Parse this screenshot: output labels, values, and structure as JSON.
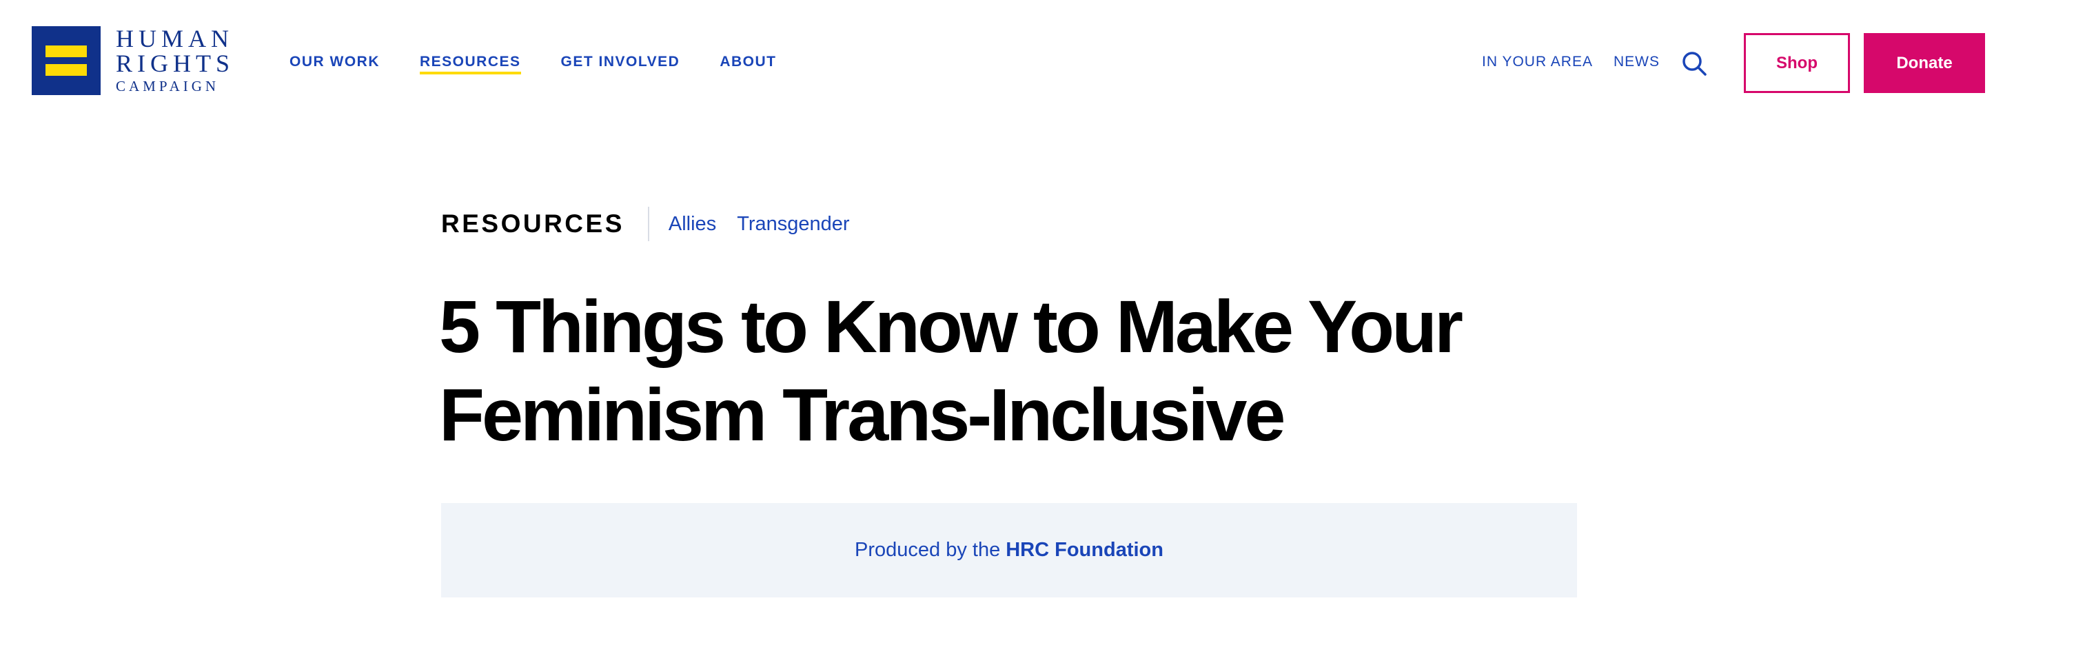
{
  "logo": {
    "line1": "HUMAN",
    "line2": "RIGHTS",
    "line3": "CAMPAIGN",
    "bg_color": "#10318a",
    "bar_color": "#fedb06"
  },
  "nav": {
    "items": [
      {
        "label": "OUR WORK"
      },
      {
        "label": "RESOURCES"
      },
      {
        "label": "GET INVOLVED"
      },
      {
        "label": "ABOUT"
      }
    ],
    "active": "RESOURCES"
  },
  "utility": {
    "in_your_area": "IN YOUR AREA",
    "news": "NEWS",
    "search_icon": "search-icon",
    "shop_label": "Shop",
    "donate_label": "Donate"
  },
  "article": {
    "section": "RESOURCES",
    "tags": [
      "Allies",
      "Transgender"
    ],
    "title": "5 Things to Know to Make Your Feminism Trans-Inclusive",
    "produced_prefix": "Produced by the",
    "producer": "HRC Foundation"
  },
  "colors": {
    "accent_blue": "#1a45b8",
    "brand_pink": "#d6086b",
    "highlight_yellow": "#fedb06",
    "panel_bg": "#f0f4f9"
  }
}
